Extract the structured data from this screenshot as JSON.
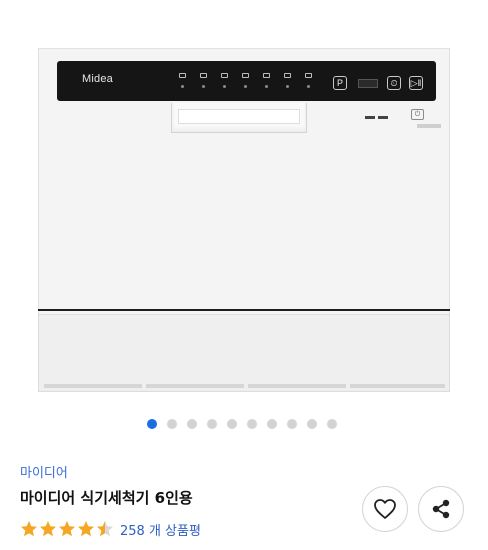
{
  "product": {
    "appliance_logo": "Midea",
    "control_buttons": [
      "P",
      "⏲",
      "▷‖"
    ],
    "power_symbol": "⏻",
    "brand": "마이디어",
    "title": "마이디어 식기세척기 6인용",
    "rating": 4.5,
    "rating_max": 5,
    "review_count": "258 개 상품평"
  },
  "carousel": {
    "total_slides": 10,
    "active_index": 0
  },
  "colors": {
    "accent": "#1a6fdf",
    "star": "#f5a623",
    "link": "#2e5fc2"
  },
  "icons": {
    "wishlist": "heart-icon",
    "share": "share-icon"
  }
}
